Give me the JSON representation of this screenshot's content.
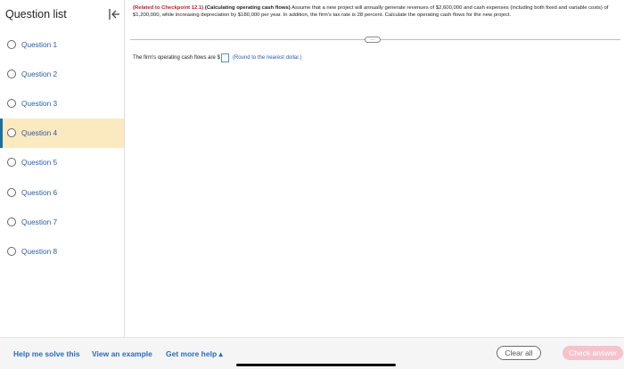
{
  "sidebar": {
    "title": "Question list",
    "collapse_icon": "collapse-left-icon",
    "questions": [
      {
        "label": "Question 1",
        "active": false
      },
      {
        "label": "Question 2",
        "active": false
      },
      {
        "label": "Question 3",
        "active": false
      },
      {
        "label": "Question 4",
        "active": true
      },
      {
        "label": "Question 5",
        "active": false
      },
      {
        "label": "Question 6",
        "active": false
      },
      {
        "label": "Question 7",
        "active": false
      },
      {
        "label": "Question 8",
        "active": false
      }
    ]
  },
  "question": {
    "reference": "(Related to Checkpoint 12.1)",
    "topic": "(Calculating operating cash flows)",
    "text": "Assume that a new project will annually generate revenues of $2,600,000 and cash expenses (including both fixed and variable costs) of $1,200,000, while increasing depreciation by $180,000 per year. In addition, the firm's tax rate is 28 percent. Calculate the operating cash flows for the new project.",
    "more_handle": "....",
    "answer_prefix": "The firm's operating cash flows are $",
    "answer_value": "",
    "answer_hint": "(Round to the nearest dollar.)"
  },
  "footer": {
    "help_solve": "Help me solve this",
    "view_example": "View an example",
    "more_help": "Get more help ▴",
    "clear_all": "Clear all",
    "check_answer": "Check answer"
  },
  "colors": {
    "link": "#2a6bbd",
    "active_bg": "#fbe9bf",
    "active_border": "#1d6ea3",
    "reference": "#b4252c",
    "check_button": "#f6c2cc"
  }
}
